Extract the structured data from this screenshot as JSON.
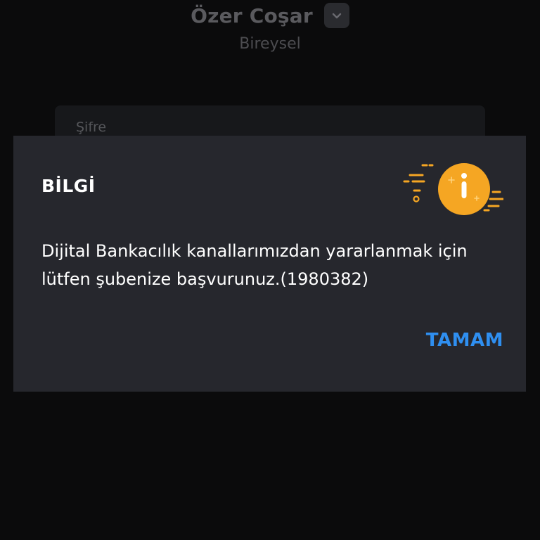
{
  "header": {
    "user_name": "Özer Coşar",
    "user_type": "Bireysel",
    "switch_icon": "chevron-down-icon"
  },
  "login_form": {
    "password_label": "Şifre"
  },
  "dialog": {
    "title": "BİLGİ",
    "message": "Dijital Bankacılık kanallarımızdan yararlanmak için lütfen şubenize başvurunuz.(1980382)",
    "confirm_label": "TAMAM",
    "icon": "info-icon",
    "colors": {
      "accent": "#f5a623",
      "button": "#2f8ff0",
      "background": "#26272d"
    }
  }
}
